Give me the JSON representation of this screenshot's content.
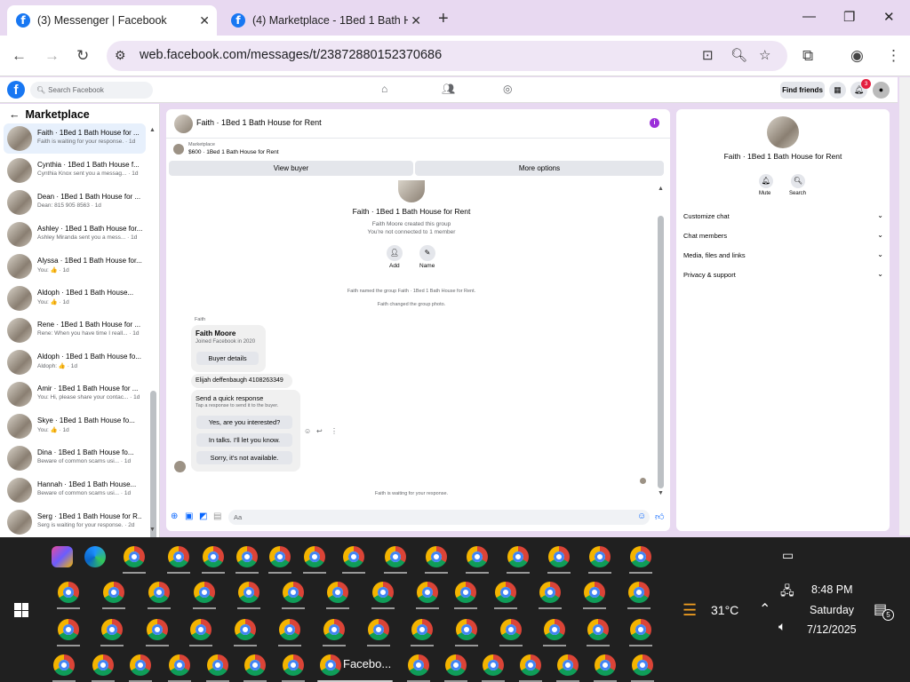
{
  "browser": {
    "tabs": [
      {
        "label": "(3) Messenger | Facebook",
        "active": true
      },
      {
        "label": "(4) Marketplace - 1Bed 1 Bath H",
        "active": false
      }
    ],
    "url": "web.facebook.com/messages/t/23872880152370686"
  },
  "fbbar": {
    "search_placeholder": "Search Facebook",
    "find_friends": "Find friends",
    "notif_count": "3"
  },
  "sidebar": {
    "title": "Marketplace",
    "conversations": [
      {
        "name": "Faith · 1Bed 1 Bath House for ...",
        "preview": "Faith is waiting for your response. · 1d",
        "selected": true
      },
      {
        "name": "Cynthia · 1Bed 1 Bath House f...",
        "preview": "Cynthia Knox sent you a messag... · 1d"
      },
      {
        "name": "Dean · 1Bed 1 Bath House for ...",
        "preview": "Dean: 815 905 8563 · 1d"
      },
      {
        "name": "Ashley · 1Bed 1 Bath House for...",
        "preview": "Ashley Miranda sent you a mess... · 1d"
      },
      {
        "name": "Alyssa · 1Bed 1 Bath House for...",
        "preview": "You: 👍 · 1d"
      },
      {
        "name": "Aldoph · 1Bed 1 Bath House...",
        "preview": "You: 👍 · 1d"
      },
      {
        "name": "Rene · 1Bed 1 Bath House for ...",
        "preview": "Rene: When you have time I reall... · 1d"
      },
      {
        "name": "Aldoph · 1Bed 1 Bath House fo...",
        "preview": "Aldoph: 👍 · 1d"
      },
      {
        "name": "Amir · 1Bed 1 Bath House for ...",
        "preview": "You: Hi, please share your contac... · 1d"
      },
      {
        "name": "Skye · 1Bed 1 Bath House fo...",
        "preview": "You: 👍 · 1d"
      },
      {
        "name": "Dina · 1Bed 1 Bath House fo...",
        "preview": "Beware of common scams usi... · 1d"
      },
      {
        "name": "Hannah · 1Bed 1 Bath House...",
        "preview": "Beware of common scams usi... · 1d"
      },
      {
        "name": "Serg · 1Bed 1 Bath House for R...",
        "preview": "Serg is waiting for your response. · 2d"
      }
    ]
  },
  "chat": {
    "title": "Faith · 1Bed 1 Bath House for Rent",
    "listing_label": "Marketplace",
    "listing_detail": "$600 · 1Bed 1 Bath House for Rent",
    "view_buyer": "View buyer",
    "more_options": "More options",
    "group_title": "Faith · 1Bed 1 Bath House for Rent",
    "created": "Faith Moore created this group",
    "not_connected": "You're not connected to 1 member",
    "add_label": "Add",
    "name_label": "Name",
    "event1": "Faith named the group Faith · 1Bed 1 Bath House for Rent.",
    "event2": "Faith changed the group photo.",
    "sender": "Faith",
    "buyer_name": "Faith Moore",
    "buyer_joined": "Joined Facebook in 2020",
    "buyer_details": "Buyer details",
    "msg_text": "Elijah deffenbaugh 4108263349",
    "quick_title": "Send a quick response",
    "quick_sub": "Tap a response to send it to the buyer.",
    "quick1": "Yes, are you interested?",
    "quick2": "In talks. I'll let you know.",
    "quick3": "Sorry, it's not available.",
    "waiting": "Faith is waiting for your response.",
    "composer_placeholder": "Aa"
  },
  "info": {
    "title": "Faith · 1Bed 1 Bath House for Rent",
    "mute": "Mute",
    "search": "Search",
    "rows": [
      "Customize chat",
      "Chat members",
      "Media, files and links",
      "Privacy & support"
    ]
  },
  "taskbar": {
    "active_label": "Facebo...",
    "temp": "31°C",
    "time": "8:48 PM",
    "day": "Saturday",
    "date": "7/12/2025",
    "notif": "5"
  }
}
